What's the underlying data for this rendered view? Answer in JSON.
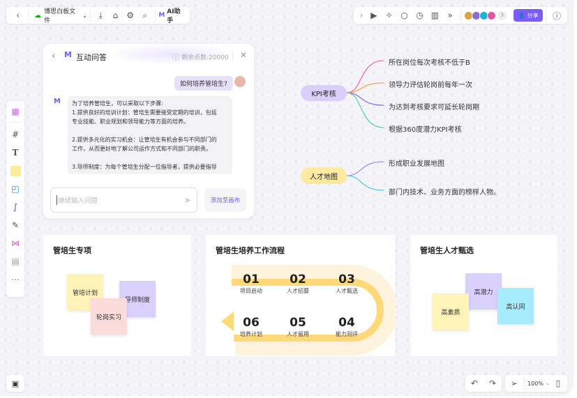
{
  "top_left_toolbar": {
    "file_name": "博思白板文件",
    "ai_label": "AI助手"
  },
  "top_right_toolbar": {
    "collaborator_count": "3",
    "share_label": "分享"
  },
  "ai_panel": {
    "title": "互动问答",
    "points": "剩余点数:20000",
    "user_question": "如何培养管培生?",
    "answer_lines": [
      "为了培养管培生，可以采取以下步骤:",
      "1.提供良好的培训计划：管培生需要接受定期的培训，包括",
      "专业技能、职业规划和领导能力等方面的培养。",
      "",
      "2.提供多元化的实习机会：让管培生有机会参与不同部门的",
      "工作，从而更好地了解公司运作方式和不同部门的职责。",
      "",
      "3.导师制度：为每个管培生分配一位指导者，提供必要指导"
    ],
    "input_placeholder": "继续输入问题",
    "add_to_canvas": "添加至画布"
  },
  "mindmap": {
    "kpi": {
      "label": "KPI考核",
      "leaves": [
        "所在岗位每次考核不低于B",
        "领导力评估轮岗前每年一次",
        "为达到考核要求可延长轮岗期",
        "根据360度潜力KPI考核"
      ]
    },
    "talent": {
      "label": "人才地图",
      "leaves": [
        "形成职业发展地图",
        "部门内技术、业务方面的榜样人物。"
      ]
    }
  },
  "cards": {
    "left": {
      "title": "管培生专项",
      "notes": [
        "管培计划",
        "导师制度",
        "轮岗实习"
      ]
    },
    "middle": {
      "title": "管培生培养工作流程",
      "steps": [
        {
          "num": "01",
          "label": "项目启动"
        },
        {
          "num": "02",
          "label": "人才招募"
        },
        {
          "num": "03",
          "label": "人才甄选"
        },
        {
          "num": "04",
          "label": "能力测评"
        },
        {
          "num": "05",
          "label": "人才留用"
        },
        {
          "num": "06",
          "label": "培养计划"
        }
      ]
    },
    "right": {
      "title": "管培生人才甄选",
      "notes": [
        "高潜力",
        "高素质",
        "高认同"
      ]
    }
  },
  "bottom": {
    "zoom": "100%"
  },
  "colors": {
    "accent": "#7b5cf5",
    "sticky_yellow": "#fff3b8",
    "sticky_purple": "#d9d0fb",
    "sticky_pink": "#fddbdb",
    "sticky_cyan": "#a8ecfb",
    "flow_yellow": "#fdd97a"
  }
}
